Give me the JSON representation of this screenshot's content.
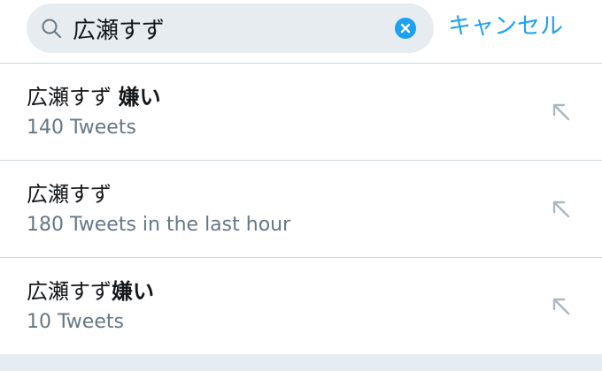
{
  "search": {
    "query": "広瀬すず",
    "cancel_label": "キャンセル"
  },
  "suggestions": [
    {
      "base": "広瀬すず ",
      "bold": "嫌い",
      "count": "140 Tweets"
    },
    {
      "base": "広瀬すず",
      "bold": "",
      "count": "180 Tweets in the last hour"
    },
    {
      "base": "広瀬すず",
      "bold": "嫌い",
      "count": "10 Tweets"
    }
  ],
  "colors": {
    "accent": "#1da1f2",
    "field_bg": "#e6ecf0",
    "secondary_text": "#657786",
    "arrow": "#aab8c2"
  },
  "icons": {
    "search": "search-icon",
    "clear": "clear-icon",
    "fill_in": "arrow-up-left-icon"
  }
}
